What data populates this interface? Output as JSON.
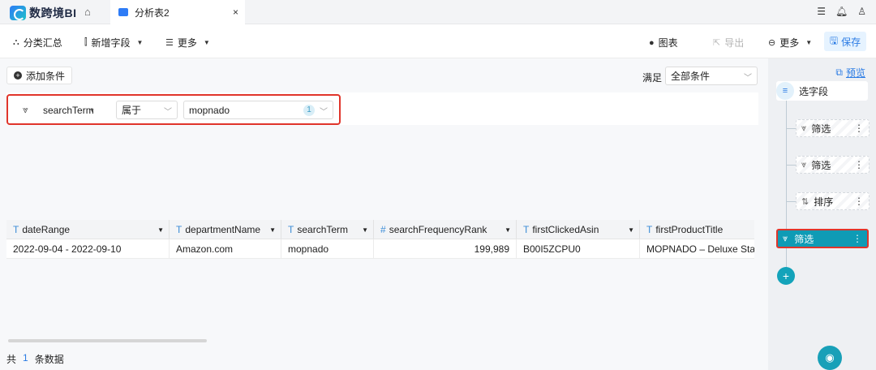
{
  "topbar": {
    "logo_text": "数跨境BI",
    "tab_label": "分析表2",
    "tab_close": "×",
    "icons": [
      "list-icon",
      "bell-icon",
      "user-icon"
    ]
  },
  "toolbar": {
    "summary": "分类汇总",
    "add_field": "新增字段",
    "more_left": "更多",
    "chart": "图表",
    "export": "导出",
    "more_right": "更多",
    "save": "保存"
  },
  "filter_bar": {
    "add_condition": "添加条件",
    "satisfy_label": "满足",
    "satisfy_value": "全部条件"
  },
  "filter_row": {
    "field": "searchTerm",
    "operator": "属于",
    "value": "mopnado",
    "value_count": "1"
  },
  "table": {
    "columns": [
      {
        "type": "T",
        "name": "dateRange"
      },
      {
        "type": "T",
        "name": "departmentName"
      },
      {
        "type": "T",
        "name": "searchTerm"
      },
      {
        "type": "#",
        "name": "searchFrequencyRank"
      },
      {
        "type": "T",
        "name": "firstClickedAsin"
      },
      {
        "type": "T",
        "name": "firstProductTitle"
      }
    ],
    "rows": [
      [
        "2022-09-04 - 2022-09-10",
        "Amazon.com",
        "mopnado",
        "199,989",
        "B00I5ZCPU0",
        "MOPNADO – Deluxe Stainle"
      ]
    ],
    "total_prefix": "共",
    "total_count": "1",
    "total_suffix": "条数据"
  },
  "steps": {
    "preview": "预览",
    "select_fields": "选字段",
    "filter_1": "筛选",
    "filter_2": "筛选",
    "sort": "排序",
    "filter_active": "筛选",
    "add": "+"
  },
  "colors": {
    "accent": "#2a7be4",
    "teal": "#0f9bb5",
    "highlight_red": "#e0352b"
  }
}
